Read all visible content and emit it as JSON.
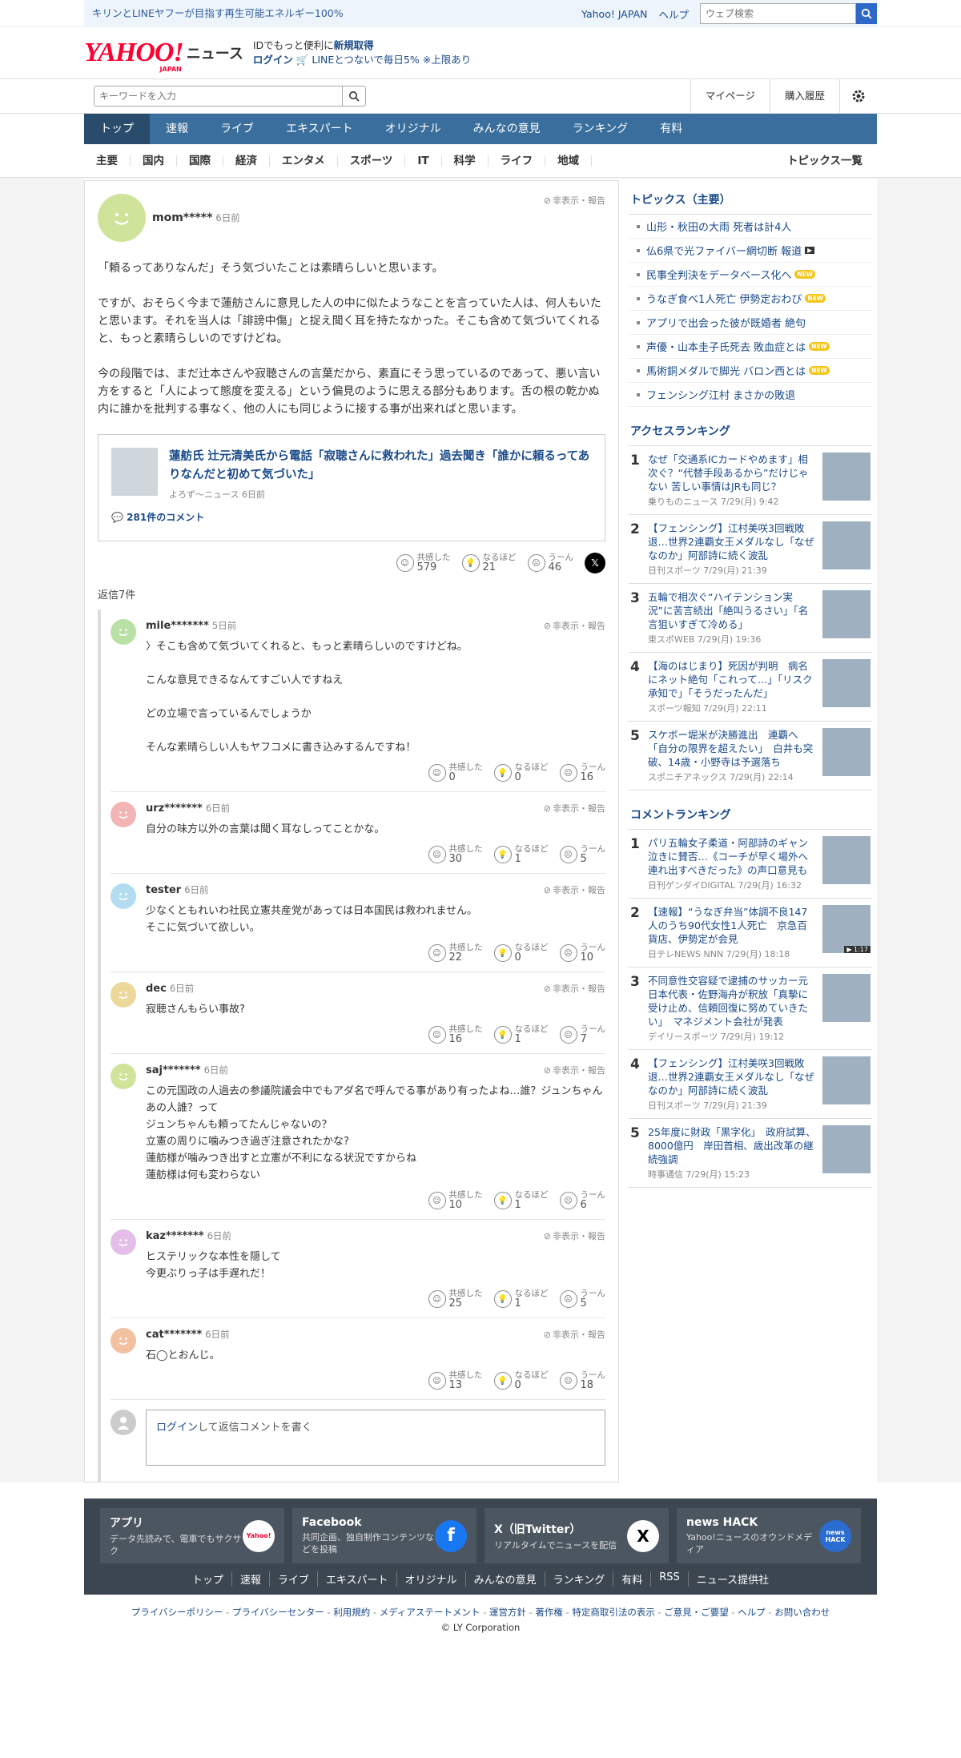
{
  "topbar": {
    "promo": "キリンとLINEヤフーが目指す再生可能エネルギー100%",
    "yahoo_japan": "Yahoo! JAPAN",
    "help": "ヘルプ",
    "web_search_placeholder": "ウェブ検索"
  },
  "header": {
    "logo_text": "YAHOO!",
    "logo_sub": "JAPAN",
    "news_label": "ニュース",
    "msg_line1_a": "IDでもっと便利に",
    "msg_line1_b": "新規取得",
    "msg_login": "ログイン",
    "msg_line2": "LINEとつないで毎日5% ※上限あり"
  },
  "search": {
    "placeholder": "キーワードを入力",
    "mypage": "マイページ",
    "history": "購入履歴"
  },
  "nav": {
    "items": [
      "トップ",
      "速報",
      "ライブ",
      "エキスパート",
      "オリジナル",
      "みんなの意見",
      "ランキング",
      "有料"
    ]
  },
  "subnav": {
    "items": [
      "主要",
      "国内",
      "国際",
      "経済",
      "エンタメ",
      "スポーツ",
      "IT",
      "科学",
      "ライフ",
      "地域"
    ],
    "all": "トピックス一覧"
  },
  "comment": {
    "user": "mom*****",
    "time": "6日前",
    "hide_label": "非表示・報告",
    "body": "「頼るってありなんだ」そう気づいたことは素晴らしいと思います。\n\nですが、おそらく今まで蓮舫さんに意見した人の中に似たようなことを言っていた人は、何人もいたと思います。それを当人は「誹謗中傷」と捉え聞く耳を持たなかった。そこも含めて気づいてくれると、もっと素晴らしいのですけどね。\n\n今の段階では、まだ辻本さんや寂聴さんの言葉だから、素直にそう思っているのであって、悪い言い方をすると「人によって態度を変える」という偏見のように思える部分もあります。舌の根の乾かぬ内に誰かを批判する事なく、他の人にも同じように接する事が出来ればと思います。",
    "article_title": "蓮舫氏 辻元清美氏から電話「寂聴さんに救われた」過去聞き「誰かに頼るってありなんだと初めて気づいた」",
    "article_source": "よろず～ニュース 6日前",
    "article_comments": "281件のコメント",
    "labels": {
      "agree": "共感した",
      "naruhodo": "なるほど",
      "umm": "うーん"
    },
    "agree": "579",
    "naruhodo": "21",
    "umm": "46",
    "replies_count": "返信7件"
  },
  "replies": [
    {
      "user": "mile*******",
      "time": "5日前",
      "color": "#b9e0a5",
      "body": "〉そこも含めて気づいてくれると、もっと素晴らしいのですけどね。\n\nこんな意見できるなんてすごい人ですねえ\n\nどの立場で言っているんでしょうか\n\nそんな素晴らしい人もヤフコメに書き込みするんですね！",
      "agree": "0",
      "naruhodo": "0",
      "umm": "16"
    },
    {
      "user": "urz*******",
      "time": "6日前",
      "color": "#f2b4b4",
      "body": "自分の味方以外の言葉は聞く耳なしってことかな。",
      "agree": "30",
      "naruhodo": "1",
      "umm": "5"
    },
    {
      "user": "tester",
      "time": "6日前",
      "color": "#b4dcf0",
      "body": "少なくともれいわ社民立憲共産党があっては日本国民は救われません。\nそこに気づいて欲しい。",
      "agree": "22",
      "naruhodo": "0",
      "umm": "10"
    },
    {
      "user": "dec",
      "time": "6日前",
      "color": "#ecd89a",
      "body": "寂聴さんもらい事故?",
      "agree": "16",
      "naruhodo": "1",
      "umm": "7"
    },
    {
      "user": "saj*******",
      "time": "6日前",
      "color": "#cfe39a",
      "body": "この元国政の人過去の参議院議会中でもアダ名で呼んでる事があり有ったよね…誰？ジュンちゃんあの人誰？って\nジュンちゃんも頼ってたんじゃないの？\n立憲の周りに噛みつき過ぎ注意されたかな?\n蓮舫様が噛みつき出すと立憲が不利になる状況ですからね\n蓮舫様は何も変わらない",
      "agree": "10",
      "naruhodo": "1",
      "umm": "6"
    },
    {
      "user": "kaz*******",
      "time": "6日前",
      "color": "#e4bde8",
      "body": "ヒステリックな本性を隠して\n今更ぶりっ子は手遅れだ！",
      "agree": "25",
      "naruhodo": "1",
      "umm": "5"
    },
    {
      "user": "cat*******",
      "time": "6日前",
      "color": "#f2c1a0",
      "body": "石◯とおんじ。",
      "agree": "13",
      "naruhodo": "0",
      "umm": "18"
    }
  ],
  "reply_form": {
    "login": "ログイン",
    "rest": "して返信コメントを書く"
  },
  "topics": {
    "title": "トピックス（主要）",
    "items": [
      {
        "text": "山形・秋田の大雨 死者は計4人",
        "badge": ""
      },
      {
        "text": "仏6県で光ファイバー網切断 報道",
        "badge": "video"
      },
      {
        "text": "民事全判決をデータベース化へ",
        "badge": "NEW"
      },
      {
        "text": "うなぎ食べ1人死亡 伊勢定おわび",
        "badge": "NEW"
      },
      {
        "text": "アプリで出会った彼が既婚者 絶句",
        "badge": ""
      },
      {
        "text": "声優・山本圭子氏死去 敗血症とは",
        "badge": "NEW"
      },
      {
        "text": "馬術銅メダルで脚光 バロン西とは",
        "badge": "NEW"
      },
      {
        "text": "フェンシング江村 まさかの敗退",
        "badge": ""
      }
    ]
  },
  "access_ranking": {
    "title": "アクセスランキング",
    "items": [
      {
        "n": "1",
        "title": "なぜ「交通系ICカードやめます」相次ぐ？“代替手段あるから”だけじゃない 苦しい事情はJRも同じ？",
        "src": "乗りものニュース 7/29(月) 9:42"
      },
      {
        "n": "2",
        "title": "【フェンシング】江村美咲3回戦敗退…世界2連覇女王メダルなし「なぜなのか」阿部詩に続く波乱",
        "src": "日刊スポーツ 7/29(月) 21:39"
      },
      {
        "n": "3",
        "title": "五輪で相次ぐ“ハイテンション実況”に苦言続出「絶叫うるさい」「名言狙いすぎて冷める」",
        "src": "東スポWEB 7/29(月) 19:36"
      },
      {
        "n": "4",
        "title": "【海のはじまり】死因が判明　病名にネット絶句「これって…」「リスク承知で」「そうだったんだ」",
        "src": "スポーツ報知 7/29(月) 22:11"
      },
      {
        "n": "5",
        "title": "スケボー堀米が決勝進出　連覇へ「自分の限界を超えたい」　白井も突破、14歳・小野寺は予選落ち",
        "src": "スポニチアネックス 7/29(月) 22:14"
      }
    ]
  },
  "comment_ranking": {
    "title": "コメントランキング",
    "items": [
      {
        "n": "1",
        "title": "パリ五輪女子柔道・阿部詩のギャン泣きに賛否…《コーチが早く場外へ連れ出すべきだった》の声口意見も",
        "src": "日刊ゲンダイDIGITAL 7/29(月) 16:32",
        "video": ""
      },
      {
        "n": "2",
        "title": "【速報】“うなぎ弁当”体調不良147人のうち90代女性1人死亡　京急百貨店、伊勢定が会見",
        "src": "日テレNEWS NNN 7/29(月) 18:18",
        "video": "▶ 1:17"
      },
      {
        "n": "3",
        "title": "不同意性交容疑で逮捕のサッカー元日本代表・佐野海舟が釈放「真摯に受け止め、信頼回復に努めていきたい」　マネジメント会社が発表",
        "src": "デイリースポーツ 7/29(月) 19:12",
        "video": ""
      },
      {
        "n": "4",
        "title": "【フェンシング】江村美咲3回戦敗退…世界2連覇女王メダルなし「なぜなのか」阿部詩に続く波乱",
        "src": "日刊スポーツ 7/29(月) 21:39",
        "video": ""
      },
      {
        "n": "5",
        "title": "25年度に財政「黒字化」　政府試算、8000億円　岸田首相、歳出改革の継続強調",
        "src": "時事通信 7/29(月) 15:23",
        "video": ""
      }
    ]
  },
  "footer": {
    "cards": [
      {
        "h": "アプリ",
        "d": "データ先読みで、電車でもサクサク",
        "icon": "Yahoo!"
      },
      {
        "h": "Facebook",
        "d": "共同企画、独自制作コンテンツなどを投稿",
        "icon": "f"
      },
      {
        "h": "X（旧Twitter）",
        "d": "リアルタイムでニュースを配信",
        "icon": "X"
      },
      {
        "h": "news HACK",
        "d": "Yahoo!ニュースのオウンドメディア",
        "icon": "news HACK"
      }
    ],
    "links": [
      "トップ",
      "速報",
      "ライブ",
      "エキスパート",
      "オリジナル",
      "みんなの意見",
      "ランキング",
      "有料",
      "RSS",
      "ニュース提供社"
    ],
    "bottom_links": [
      "プライバシーポリシー",
      "プライバシーセンター",
      "利用規約",
      "メディアステートメント",
      "運営方針",
      "著作権",
      "特定商取引法の表示",
      "ご意見・ご要望",
      "ヘルプ",
      "お問い合わせ"
    ],
    "copyright": "© LY Corporation"
  }
}
